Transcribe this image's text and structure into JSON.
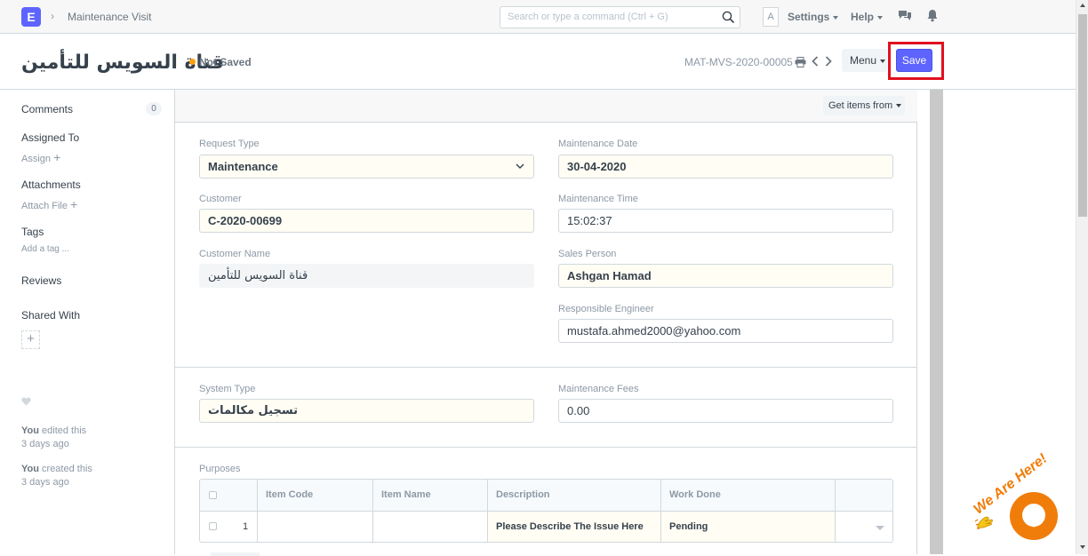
{
  "navbar": {
    "logo_letter": "E",
    "breadcrumb": "Maintenance Visit",
    "search_placeholder": "Search or type a command (Ctrl + G)",
    "avatar_letter": "A",
    "settings_label": "Settings",
    "help_label": "Help"
  },
  "page": {
    "title": "قناة السويس للتأمين",
    "status": "Not Saved",
    "doc_name": "MAT-MVS-2020-00005",
    "menu_label": "Menu",
    "save_label": "Save"
  },
  "sidebar": {
    "comments_label": "Comments",
    "comments_count": "0",
    "assigned_to_label": "Assigned To",
    "assign_label": "Assign",
    "attachments_label": "Attachments",
    "attach_file_label": "Attach File",
    "tags_label": "Tags",
    "add_tag_label": "Add a tag ...",
    "reviews_label": "Reviews",
    "shared_with_label": "Shared With",
    "activity": [
      {
        "who": "You",
        "action": "edited this",
        "when": "3 days ago"
      },
      {
        "who": "You",
        "action": "created this",
        "when": "3 days ago"
      }
    ]
  },
  "toolbar": {
    "get_items_label": "Get items from"
  },
  "form": {
    "request_type": {
      "label": "Request Type",
      "value": "Maintenance"
    },
    "customer": {
      "label": "Customer",
      "value": "C-2020-00699"
    },
    "customer_name": {
      "label": "Customer Name",
      "value": "قناة السويس للتأمين"
    },
    "maintenance_date": {
      "label": "Maintenance Date",
      "value": "30-04-2020"
    },
    "maintenance_time": {
      "label": "Maintenance Time",
      "value": "15:02:37"
    },
    "sales_person": {
      "label": "Sales Person",
      "value": "Ashgan Hamad"
    },
    "responsible_engineer": {
      "label": "Responsible Engineer",
      "value": "mustafa.ahmed2000@yahoo.com"
    },
    "system_type": {
      "label": "System Type",
      "value": "تسجيل مكالمات"
    },
    "maintenance_fees": {
      "label": "Maintenance Fees",
      "value": "0.00"
    }
  },
  "purposes": {
    "label": "Purposes",
    "columns": [
      "Item Code",
      "Item Name",
      "Description",
      "Work Done"
    ],
    "rows": [
      {
        "idx": "1",
        "item_code": "",
        "item_name": "",
        "description": "Please Describe The Issue Here",
        "work_done": "Pending"
      }
    ]
  },
  "chat_widget": {
    "tagline": "We Are Here!",
    "accent_color": "#f07d0a"
  },
  "colors": {
    "primary": "#5e64ff",
    "indicator_orange": "#ffa00a",
    "highlight_red": "#e0101f"
  }
}
